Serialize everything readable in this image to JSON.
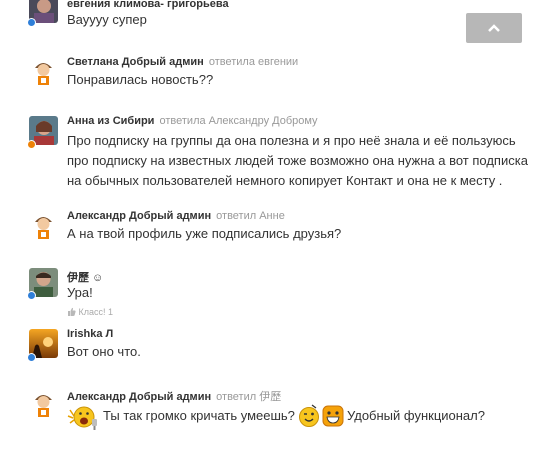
{
  "comments": [
    {
      "author": "евгения климова- григорьева",
      "reply": "",
      "text": "Вауууу супер"
    },
    {
      "author": "Светлана Добрый админ",
      "reply": "ответила евгении",
      "text": "Понравилась новость??"
    },
    {
      "author": "Анна из Сибири",
      "reply": "ответила Александру Доброму",
      "lines": [
        "Про подписку на группы да она полезна и я про неё знала и её пользуюсь",
        "про подписку на известных людей тоже возможно она нужна а вот подписка",
        "на обычных пользователей немного копирует Контакт и она не к месту ."
      ]
    },
    {
      "author": "Александр Добрый админ",
      "reply": "ответил Анне",
      "text": "А на твой профиль уже подписались друзья?"
    },
    {
      "author": "伊歷 ☺",
      "reply": "",
      "text": "Ура!",
      "like": "Класс! 1"
    },
    {
      "author": "Irishka Л",
      "reply": "",
      "text": "Вот оно что."
    },
    {
      "author": "Александр Добрый админ",
      "reply": "ответил 伊歷",
      "text_a": "Ты так громко кричать умеешь?",
      "text_b": "Удобный функционал?"
    }
  ],
  "colors": {
    "online": "#2f7fd8",
    "accent_orange": "#ee8208",
    "scroll_button": "#b7b7b7"
  },
  "icons": {
    "scroll_top": "chevron-up-icon",
    "like": "thumb-up-icon"
  }
}
